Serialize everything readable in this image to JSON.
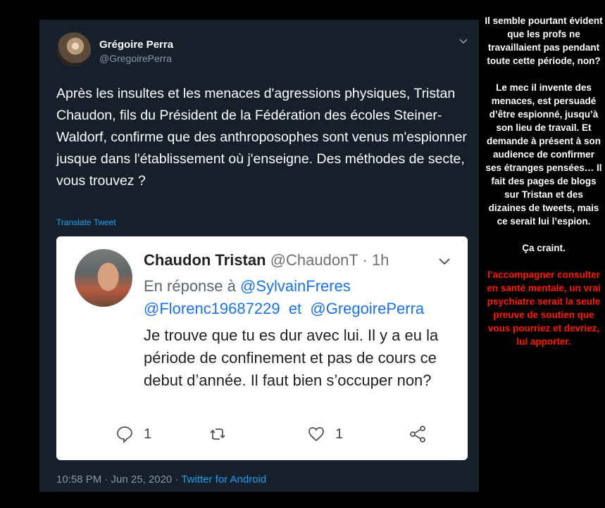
{
  "tweet": {
    "author_name": "Grégoire Perra",
    "author_handle": "@GregoirePerra",
    "text": "Après les insultes et les menaces d'agressions physiques, Tristan Chaudon, fils du Président de la Fédération des écoles Steiner-Waldorf, confirme que des anthroposophes sont venus m'espionner jusque dans l'établissement où  j'enseigne. Des méthodes de secte, vous trouvez ?",
    "translate_label": "Translate Tweet",
    "timestamp": "10:58 PM · Jun 25, 2020",
    "separator": " · ",
    "source": "Twitter for Android"
  },
  "quoted": {
    "name": "Chaudon Tristan",
    "handle": "@ChaudonT",
    "time": "· 1h",
    "reply_prefix": "En réponse à",
    "mention1": "@SylvainFreres",
    "mention2": "@Florenc19687229",
    "reply_and": "et",
    "mention3": "@GregoirePerra",
    "text": "Je trouve que tu es dur avec lui. Il y a eu la période de confinement et pas de cours ce debut d’année. Il faut bien s’occuper non?",
    "reply_count": "1",
    "like_count": "1"
  },
  "sidebar": {
    "para1": "Il semble pourtant évident que les profs ne travaillaient pas pendant toute cette période, non?",
    "para2": "Le mec il invente des menaces, est persuadé d’être espionné, jusqu’à son lieu de travail. Et demande à présent à son audience de confirmer ses étranges pensées… Il fait des pages de blogs sur Tristan et des dizaines de tweets, mais ce serait lui l’espion.",
    "para3": "Ça craint.",
    "para4": "l’accompagner consulter en santé mentale, un vrai psychiatre serait la seule preuve de soutien que vous pourriez et devriez, lui apporter."
  },
  "colors": {
    "card_bg": "#15202b",
    "accent": "#1da1f2",
    "sidebar_red": "#ff1a00"
  },
  "icons": [
    "chevron-down-icon",
    "reply-icon",
    "retweet-icon",
    "like-icon",
    "share-icon"
  ]
}
